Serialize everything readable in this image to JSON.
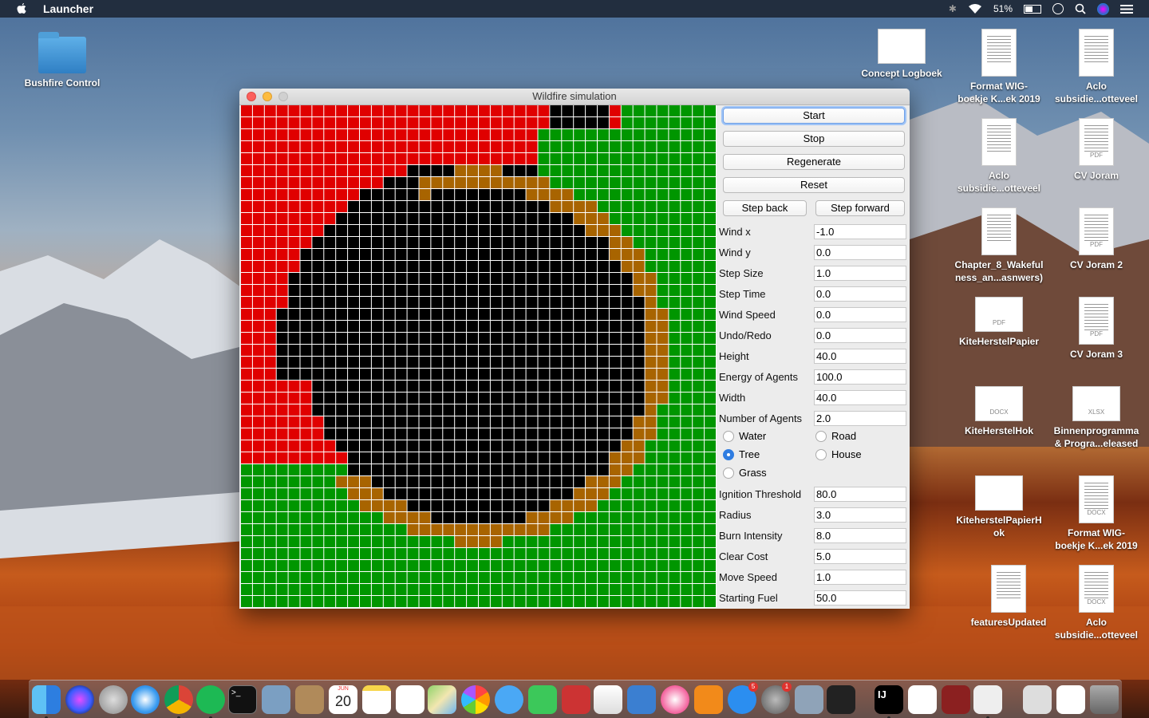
{
  "menubar": {
    "app_name": "Launcher",
    "battery": "51%"
  },
  "desktop_icons": [
    {
      "label": "Bushfire Control",
      "kind": "folder"
    },
    {
      "label": "Concept Logboek",
      "kind": "sheet"
    },
    {
      "label": "Format WIG-\nboekje K...ek 2019",
      "kind": "doc"
    },
    {
      "label": "Aclo\nsubsidie...otteveel",
      "kind": "doc"
    },
    {
      "label": "Aclo\nsubsidie...otteveel",
      "kind": "doc"
    },
    {
      "label": "CV Joram",
      "kind": "pdf",
      "tag": "PDF"
    },
    {
      "label": "Chapter_8_Wakeful\nness_an...asnwers)",
      "kind": "doc"
    },
    {
      "label": "CV Joram 2",
      "kind": "pdf",
      "tag": "PDF"
    },
    {
      "label": "KiteHerstelPapier",
      "kind": "wide",
      "tag": "PDF"
    },
    {
      "label": "CV Joram 3",
      "kind": "pdf",
      "tag": "PDF"
    },
    {
      "label": "KiteHerstelHok",
      "kind": "wide",
      "tag": "DOCX"
    },
    {
      "label": "Binnenprogramma\n& Progra...eleased",
      "kind": "wide",
      "tag": "XLSX"
    },
    {
      "label": "KiteherstelPapierH\nok",
      "kind": "wide",
      "tag": ""
    },
    {
      "label": "Format WIG-\nboekje K...ek 2019",
      "kind": "doc",
      "tag": "DOCX"
    },
    {
      "label": "featuresUpdated",
      "kind": "doc"
    },
    {
      "label": "Aclo\nsubsidie...otteveel",
      "kind": "doc",
      "tag": "DOCX"
    }
  ],
  "window": {
    "title": "Wildfire simulation"
  },
  "buttons": {
    "start": "Start",
    "stop": "Stop",
    "regenerate": "Regenerate",
    "reset": "Reset",
    "step_back": "Step back",
    "step_forward": "Step forward"
  },
  "params_top": [
    {
      "label": "Wind x",
      "value": "-1.0"
    },
    {
      "label": "Wind y",
      "value": "0.0"
    },
    {
      "label": "Step Size",
      "value": "1.0"
    },
    {
      "label": "Step Time",
      "value": "0.0"
    },
    {
      "label": "Wind Speed",
      "value": "0.0"
    },
    {
      "label": "Undo/Redo",
      "value": "0.0"
    },
    {
      "label": "Height",
      "value": "40.0"
    },
    {
      "label": "Energy of Agents",
      "value": "100.0"
    },
    {
      "label": "Width",
      "value": "40.0"
    },
    {
      "label": "Number of Agents",
      "value": "2.0"
    }
  ],
  "terrain_options": [
    {
      "label": "Water",
      "selected": false
    },
    {
      "label": "Road",
      "selected": false
    },
    {
      "label": "Tree",
      "selected": true
    },
    {
      "label": "House",
      "selected": false
    },
    {
      "label": "Grass",
      "selected": false
    }
  ],
  "params_bottom": [
    {
      "label": "Ignition Threshold",
      "value": "80.0"
    },
    {
      "label": "Radius",
      "value": "3.0"
    },
    {
      "label": "Burn Intensity",
      "value": "8.0"
    },
    {
      "label": "Clear Cost",
      "value": "5.0"
    },
    {
      "label": "Move Speed",
      "value": "1.0"
    },
    {
      "label": "Starting Fuel",
      "value": "50.0"
    }
  ],
  "grid": {
    "columns": 40,
    "rows": 42,
    "colors": {
      "burnt": "#000000",
      "burning": "#e00000",
      "igniting": "#ff9900",
      "firebreak": "#a86400",
      "tree": "#009600",
      "gridline": "#ffffff"
    }
  },
  "dock": {
    "calendar_month": "JUN",
    "calendar_day": "20",
    "appstore_badge": "5",
    "settings_badge": "1"
  }
}
